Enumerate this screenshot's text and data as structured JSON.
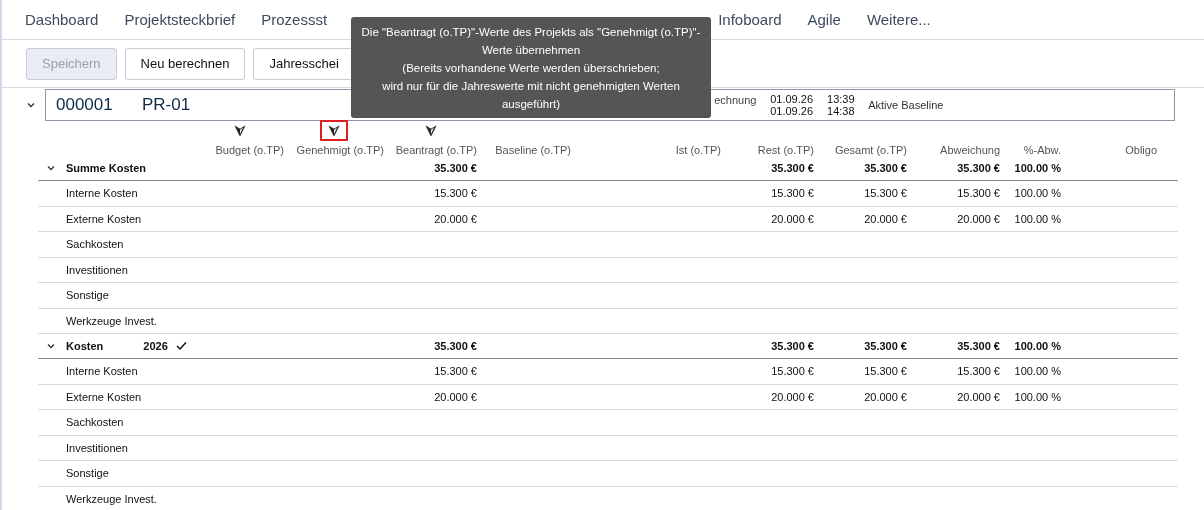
{
  "tabs": [
    {
      "label": "Dashboard",
      "selected": false
    },
    {
      "label": "Projektsteckbrief",
      "selected": false
    },
    {
      "label": "Prozessst",
      "selected": false
    },
    {
      "label": "Infoboard",
      "selected": false
    },
    {
      "label": "Agile",
      "selected": false
    },
    {
      "label": "Weitere...",
      "selected": false
    }
  ],
  "toolbar": [
    {
      "label": "Speichern",
      "disabled": true
    },
    {
      "label": "Neu berechnen",
      "disabled": false
    },
    {
      "label": "Jahresschei",
      "disabled": false
    }
  ],
  "project": {
    "expanded": true,
    "number": "000001",
    "code": "PR-01",
    "label": "echnung",
    "dates": [
      {
        "date": "01.09.26",
        "time": "13:39"
      },
      {
        "date": "01.09.26",
        "time": "14:38"
      }
    ],
    "baseline": "Aktive Baseline"
  },
  "columns": [
    {
      "label": "Budget (o.TP)",
      "filter": true
    },
    {
      "label": "Genehmigt (o.TP)",
      "filter": true,
      "tooltip": {
        "lines": [
          "Die \"Beantragt (o.TP)\"-Werte des Projekts als \"Genehmigt (o.TP)\"-",
          "Werte übernehmen",
          "(Bereits vorhandene Werte werden überschrieben;",
          "wird nur für die Jahreswerte mit nicht genehmigten Werten",
          "ausgeführt)"
        ]
      }
    },
    {
      "label": "Beantragt (o.TP)",
      "filter": true
    },
    {
      "label": "Baseline (o.TP)",
      "filter": false
    },
    {
      "label": "Ist (o.TP)",
      "filter": false
    },
    {
      "label": "Rest (o.TP)",
      "filter": false
    },
    {
      "label": "Gesamt (o.TP)",
      "filter": false
    },
    {
      "label": "Abweichung",
      "filter": false
    },
    {
      "label": "%-Abw.",
      "filter": false
    },
    {
      "label": "Obligo",
      "filter": false
    }
  ],
  "groups": [
    {
      "label": "Summe Kosten",
      "expanded": true,
      "values": [
        {
          "kind": "beantragt",
          "text": "35.300 €"
        },
        {
          "kind": "rest",
          "text": "35.300 €"
        },
        {
          "kind": "gesamt",
          "text": "35.300 €"
        },
        {
          "kind": "abweichung",
          "text": "35.300 €"
        },
        {
          "kind": "prozent",
          "text": "100.00 %"
        }
      ],
      "rows": [
        {
          "label": "Interne Kosten",
          "values": [
            {
              "kind": "beantragt",
              "text": "15.300 €"
            },
            {
              "kind": "rest",
              "text": "15.300 €"
            },
            {
              "kind": "gesamt",
              "text": "15.300 €"
            },
            {
              "kind": "abweichung",
              "text": "15.300 €"
            },
            {
              "kind": "prozent",
              "text": "100.00 %"
            }
          ]
        },
        {
          "label": "Externe Kosten",
          "values": [
            {
              "kind": "beantragt",
              "text": "20.000 €"
            },
            {
              "kind": "rest",
              "text": "20.000 €"
            },
            {
              "kind": "gesamt",
              "text": "20.000 €"
            },
            {
              "kind": "abweichung",
              "text": "20.000 €"
            },
            {
              "kind": "prozent",
              "text": "100.00 %"
            }
          ]
        },
        {
          "label": "Sachkosten"
        },
        {
          "label": "Investitionen"
        },
        {
          "label": "Sonstige"
        },
        {
          "label": "Werkzeuge Invest."
        }
      ]
    },
    {
      "label": "Kosten",
      "year": "2026",
      "checked": true,
      "expanded": true,
      "values": [
        {
          "kind": "beantragt",
          "text": "35.300 €"
        },
        {
          "kind": "rest",
          "text": "35.300 €"
        },
        {
          "kind": "gesamt",
          "text": "35.300 €"
        },
        {
          "kind": "abweichung",
          "text": "35.300 €"
        },
        {
          "kind": "prozent",
          "text": "100.00 %"
        }
      ],
      "rows": [
        {
          "label": "Interne Kosten",
          "values": [
            {
              "kind": "beantragt",
              "text": "15.300 €"
            },
            {
              "kind": "rest",
              "text": "15.300 €"
            },
            {
              "kind": "gesamt",
              "text": "15.300 €"
            },
            {
              "kind": "abweichung",
              "text": "15.300 €"
            },
            {
              "kind": "prozent",
              "text": "100.00 %"
            }
          ]
        },
        {
          "label": "Externe Kosten",
          "values": [
            {
              "kind": "beantragt",
              "text": "20.000 €"
            },
            {
              "kind": "rest",
              "text": "20.000 €"
            },
            {
              "kind": "gesamt",
              "text": "20.000 €"
            },
            {
              "kind": "abweichung",
              "text": "20.000 €"
            },
            {
              "kind": "prozent",
              "text": "100.00 %"
            }
          ]
        },
        {
          "label": "Sachkosten"
        },
        {
          "label": "Investitionen"
        },
        {
          "label": "Sonstige"
        },
        {
          "label": "Werkzeuge Invest."
        }
      ]
    }
  ]
}
